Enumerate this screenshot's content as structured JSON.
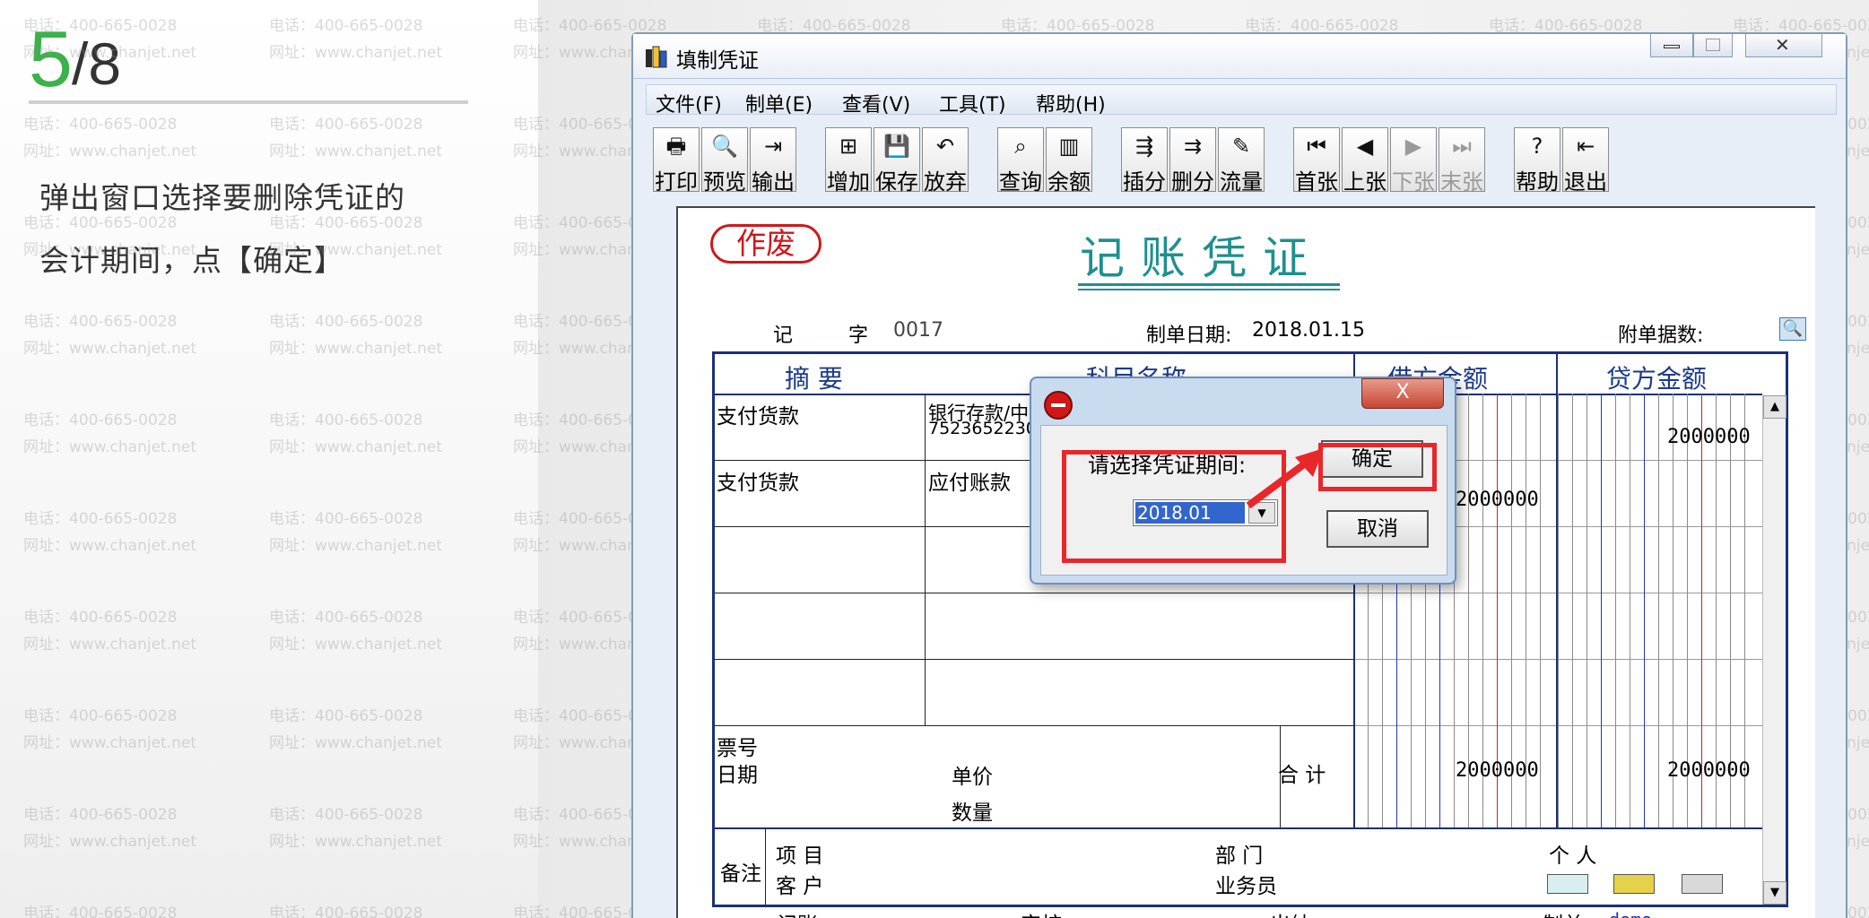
{
  "step": {
    "current": "5",
    "total": "/8"
  },
  "instruction": [
    "弹出窗口选择要删除凭证的",
    "会计期间，点【确定】"
  ],
  "watermark": {
    "phone": "电话：400-665-0028",
    "web": "网址：www.chanjet.net"
  },
  "window": {
    "title": "填制凭证",
    "menu": [
      "文件(F)",
      "制单(E)",
      "查看(V)",
      "工具(T)",
      "帮助(H)"
    ],
    "toolbar": [
      {
        "label": "打印",
        "icon": "print-icon",
        "glyph": "🖶",
        "enabled": true
      },
      {
        "label": "预览",
        "icon": "preview-icon",
        "glyph": "🔍",
        "enabled": true
      },
      {
        "label": "输出",
        "icon": "export-icon",
        "glyph": "⇥",
        "enabled": true
      },
      {
        "label": "增加",
        "icon": "add-icon",
        "glyph": "⊞",
        "enabled": true
      },
      {
        "label": "保存",
        "icon": "save-icon",
        "glyph": "💾",
        "enabled": true
      },
      {
        "label": "放弃",
        "icon": "undo-icon",
        "glyph": "↶",
        "enabled": true
      },
      {
        "label": "查询",
        "icon": "binoculars-icon",
        "glyph": "⌕",
        "enabled": true
      },
      {
        "label": "余额",
        "icon": "bar-chart-icon",
        "glyph": "▥",
        "enabled": true
      },
      {
        "label": "插分",
        "icon": "insert-row-icon",
        "glyph": "⇶",
        "enabled": true
      },
      {
        "label": "删分",
        "icon": "delete-row-icon",
        "glyph": "⇉",
        "enabled": true
      },
      {
        "label": "流量",
        "icon": "pen-icon",
        "glyph": "✎",
        "enabled": true
      },
      {
        "label": "首张",
        "icon": "first-icon",
        "glyph": "⏮",
        "enabled": true
      },
      {
        "label": "上张",
        "icon": "prev-icon",
        "glyph": "◀",
        "enabled": true
      },
      {
        "label": "下张",
        "icon": "next-icon",
        "glyph": "▶",
        "enabled": false
      },
      {
        "label": "末张",
        "icon": "last-icon",
        "glyph": "⏭",
        "enabled": false
      },
      {
        "label": "帮助",
        "icon": "help-icon",
        "glyph": "?",
        "enabled": true
      },
      {
        "label": "退出",
        "icon": "exit-icon",
        "glyph": "⇤",
        "enabled": true
      }
    ]
  },
  "voucher": {
    "void_stamp": "作废",
    "title": "记账凭证",
    "type_label": "记",
    "number_label": "字",
    "number": "0017",
    "date_label": "制单日期:",
    "date": "2018.01.15",
    "attachments_label": "附单据数:",
    "headers": {
      "summary": "摘 要",
      "account": "科目名称",
      "debit": "借方金额",
      "credit": "贷方金额"
    },
    "rows": [
      {
        "summary": "支付货款",
        "account": "银行存款/中行罢湖支行/人民币户",
        "account_sub": "7523652230",
        "debit": "",
        "credit": "2000000"
      },
      {
        "summary": "支付货款",
        "account": "应付账款",
        "account_sub": "",
        "debit": "2000000",
        "credit": ""
      }
    ],
    "ticket_label": "票号",
    "date_field_label": "日期",
    "price_label": "单价",
    "qty_label": "数量",
    "total_label": "合 计",
    "total_debit": "2000000",
    "total_credit": "2000000",
    "remark_label": "备注",
    "project_label": "项 目",
    "customer_label": "客 户",
    "dept_label": "部 门",
    "staff_label": "业务员",
    "person_label": "个 人",
    "footer": {
      "bookkeeping": "记账",
      "review": "审核",
      "cashier": "出纳",
      "maker": "制单",
      "maker_name": "demo"
    }
  },
  "dialog": {
    "close": "X",
    "label": "请选择凭证期间:",
    "period": "2018.01",
    "ok": "确定",
    "cancel": "取消"
  },
  "colors": {
    "accent_green": "#3bb14a",
    "highlight_red": "#e8272b",
    "title_teal": "#1f8f8f",
    "grid_navy": "#1c2f7a"
  }
}
